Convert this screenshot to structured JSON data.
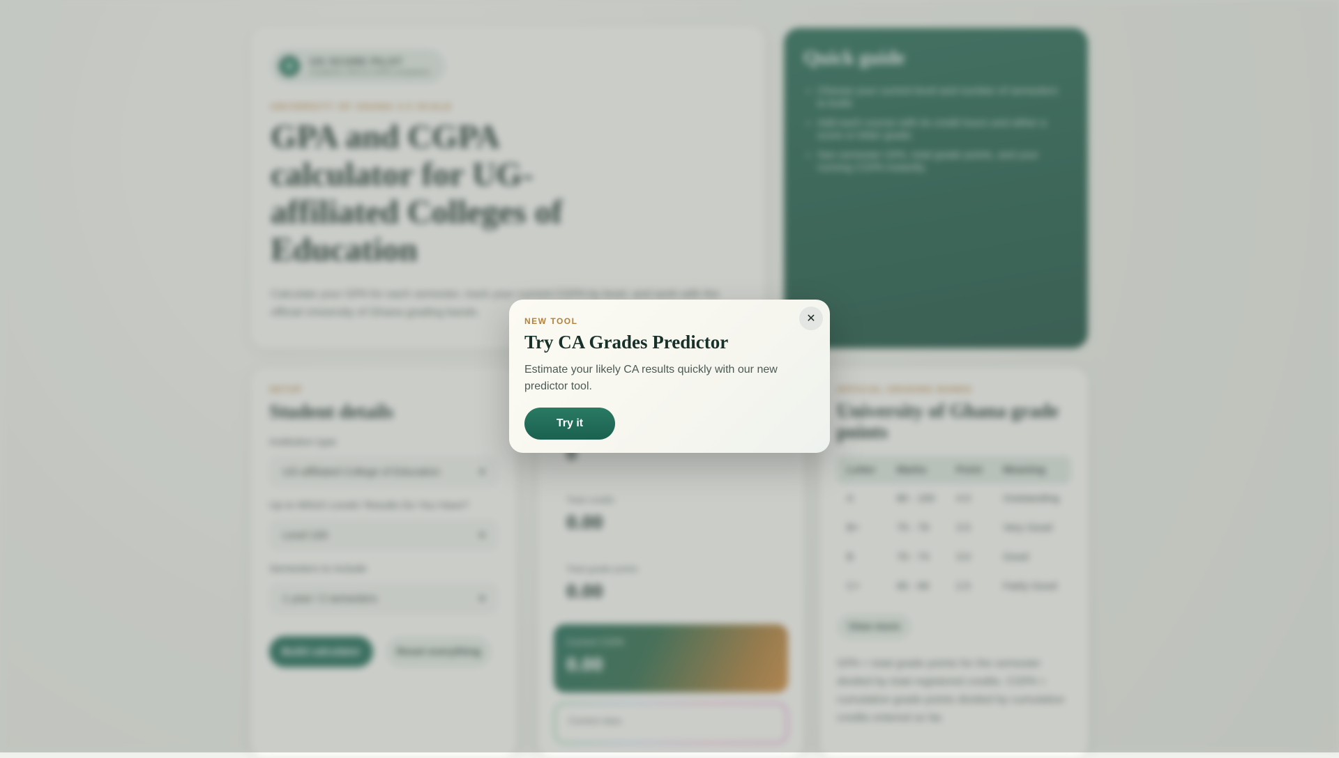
{
  "hero": {
    "badge_title": "UG SCORE PILOT",
    "badge_subtitle": "Academic GPA & CGPA companion",
    "eyebrow": "UNIVERSITY OF GHANA 4.0 SCALE",
    "title": "GPA and CGPA calculator for UG-affiliated Colleges of Education",
    "description": "Calculate your GPA for each semester, track your current CGPA by level, and work with the official University of Ghana grading bands."
  },
  "guide": {
    "title": "Quick guide",
    "items": [
      "Choose your current level and number of semesters to build.",
      "Add each course with its credit hours and either a score or letter grade.",
      "See semester GPA, total grade points, and your running CGPA instantly."
    ]
  },
  "setup": {
    "eyebrow": "SETUP",
    "title": "Student details",
    "institution_label": "Institution type",
    "institution_value": "UG-affiliated College of Education",
    "levels_label": "Up to Which Levels' Results Do You Have?",
    "levels_value": "Level 100",
    "semesters_label": "Semesters to include",
    "semesters_value": "1 year / 2 semesters",
    "build_button": "Build calculator",
    "reset_button": "Reset everything"
  },
  "stats": {
    "first_value": "0",
    "credits_label": "Total credits",
    "credits_value": "0.00",
    "points_label": "Total grade points",
    "points_value": "0.00",
    "cgpa_label": "Current CGPA",
    "cgpa_value": "0.00",
    "class_label": "Current class"
  },
  "grades": {
    "eyebrow": "OFFICIAL GRADING BANDS",
    "title": "University of Ghana grade points",
    "columns": [
      "Letter",
      "Marks",
      "Point",
      "Meaning"
    ],
    "rows": [
      [
        "A",
        "80 - 100",
        "4.0",
        "Outstanding"
      ],
      [
        "B+",
        "75 - 79",
        "3.5",
        "Very Good"
      ],
      [
        "B",
        "70 - 74",
        "3.0",
        "Good"
      ],
      [
        "C+",
        "65 - 69",
        "2.5",
        "Fairly Good"
      ]
    ],
    "view_more": "View more",
    "explanation": "GPA = total grade points for the semester divided by total registered credits. CGPA = cumulative grade points divided by cumulative credits entered so far."
  },
  "modal": {
    "eyebrow": "NEW TOOL",
    "title": "Try CA Grades Predictor",
    "text": "Estimate your likely CA results quickly with our new predictor tool.",
    "button": "Try it",
    "close_symbol": "✕"
  },
  "colors": {
    "brand_green": "#1d6a56",
    "accent_gold": "#b5803a",
    "page_background": "#f1f3ef"
  },
  "icons": {
    "badge_icon": "shield-icon",
    "select_icon": "chevron-down-icon",
    "close_icon": "close-icon"
  }
}
